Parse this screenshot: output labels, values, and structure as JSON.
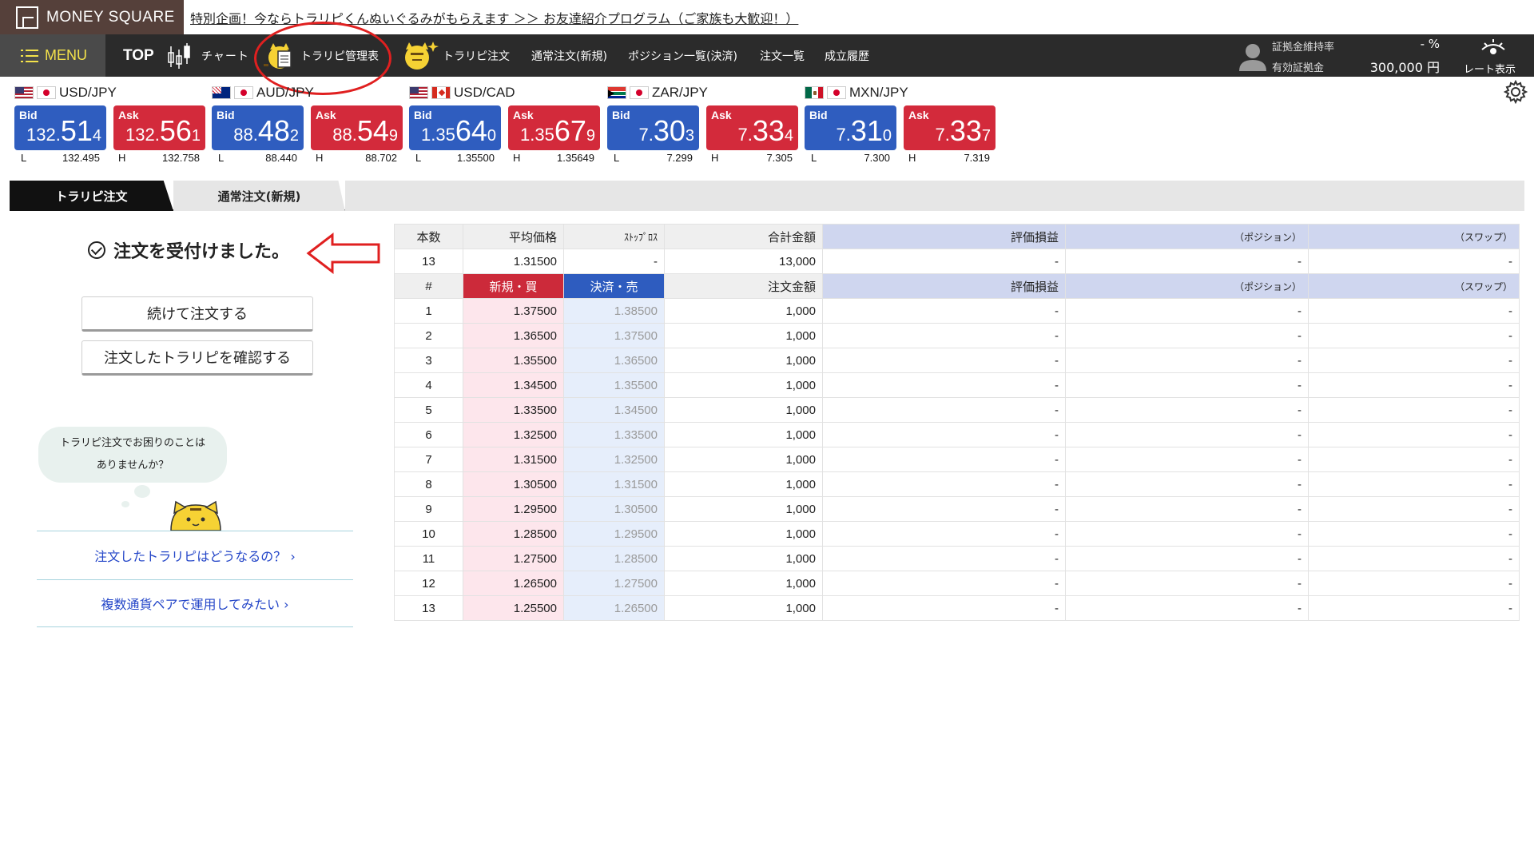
{
  "header": {
    "logo_text": "MONEY SQUARE",
    "promo": "特別企画！今ならトラリピくんぬいぐるみがもらえます ＞＞ お友達紹介プログラム（ご家族も大歓迎！）"
  },
  "nav": {
    "menu": "MENU",
    "top": "TOP",
    "chart": "チャート",
    "trarip_table": "トラリピ管理表",
    "trarip_order": "トラリピ注文",
    "normal_order": "通常注文(新規)",
    "positions": "ポジション一覧(決済)",
    "orders": "注文一覧",
    "history": "成立履歴",
    "margin_rate_label": "証拠金維持率",
    "margin_rate_value": "- %",
    "effective_margin_label": "有効証拠金",
    "effective_margin_value": "300,000 円",
    "rate_display": "レート表示"
  },
  "rates": [
    {
      "pair": "USD/JPY",
      "flags": [
        "us",
        "jp"
      ],
      "bid": {
        "a": "132.",
        "b": "51",
        "c": "4"
      },
      "ask": {
        "a": "132.",
        "b": "56",
        "c": "1"
      },
      "low": "132.495",
      "high": "132.758"
    },
    {
      "pair": "AUD/JPY",
      "flags": [
        "au",
        "jp"
      ],
      "bid": {
        "a": "88.",
        "b": "48",
        "c": "2"
      },
      "ask": {
        "a": "88.",
        "b": "54",
        "c": "9"
      },
      "low": "88.440",
      "high": "88.702"
    },
    {
      "pair": "USD/CAD",
      "flags": [
        "us",
        "ca"
      ],
      "bid": {
        "a": "1.35",
        "b": "64",
        "c": "0"
      },
      "ask": {
        "a": "1.35",
        "b": "67",
        "c": "9"
      },
      "low": "1.35500",
      "high": "1.35649"
    },
    {
      "pair": "ZAR/JPY",
      "flags": [
        "za",
        "jp"
      ],
      "bid": {
        "a": "7.",
        "b": "30",
        "c": "3"
      },
      "ask": {
        "a": "7.",
        "b": "33",
        "c": "4"
      },
      "low": "7.299",
      "high": "7.305"
    },
    {
      "pair": "MXN/JPY",
      "flags": [
        "mx",
        "jp"
      ],
      "bid": {
        "a": "7.",
        "b": "31",
        "c": "0"
      },
      "ask": {
        "a": "7.",
        "b": "33",
        "c": "7"
      },
      "low": "7.300",
      "high": "7.319"
    }
  ],
  "labels": {
    "bid": "Bid",
    "ask": "Ask",
    "low": "L",
    "high": "H"
  },
  "tabs": [
    {
      "label": "トラリピ注文",
      "active": true
    },
    {
      "label": "通常注文(新規)",
      "active": false
    }
  ],
  "result": {
    "message": "注文を受付けました。",
    "continue_button": "続けて注文する",
    "confirm_button": "注文したトラリピを確認する",
    "bubble_line1": "トラリピ注文でお困りのことは",
    "bubble_line2": "ありませんか？",
    "link1": "注文したトラリピはどうなるの？ ›",
    "link2": "複数通貨ペアで運用してみたい ›"
  },
  "summary_table": {
    "headers": [
      "本数",
      "平均価格",
      "ｽﾄｯﾌﾟﾛｽ",
      "合計金額",
      "評価損益",
      "（ポジション）",
      "（スワップ）"
    ],
    "row": [
      "13",
      "1.31500",
      "-",
      "13,000",
      "-",
      "-",
      "-"
    ]
  },
  "detail_table": {
    "headers": [
      "#",
      "新規・買",
      "決済・売",
      "注文金額",
      "評価損益",
      "（ポジション）",
      "（スワップ）"
    ],
    "rows": [
      [
        "1",
        "1.37500",
        "1.38500",
        "1,000",
        "-",
        "-",
        "-"
      ],
      [
        "2",
        "1.36500",
        "1.37500",
        "1,000",
        "-",
        "-",
        "-"
      ],
      [
        "3",
        "1.35500",
        "1.36500",
        "1,000",
        "-",
        "-",
        "-"
      ],
      [
        "4",
        "1.34500",
        "1.35500",
        "1,000",
        "-",
        "-",
        "-"
      ],
      [
        "5",
        "1.33500",
        "1.34500",
        "1,000",
        "-",
        "-",
        "-"
      ],
      [
        "6",
        "1.32500",
        "1.33500",
        "1,000",
        "-",
        "-",
        "-"
      ],
      [
        "7",
        "1.31500",
        "1.32500",
        "1,000",
        "-",
        "-",
        "-"
      ],
      [
        "8",
        "1.30500",
        "1.31500",
        "1,000",
        "-",
        "-",
        "-"
      ],
      [
        "9",
        "1.29500",
        "1.30500",
        "1,000",
        "-",
        "-",
        "-"
      ],
      [
        "10",
        "1.28500",
        "1.29500",
        "1,000",
        "-",
        "-",
        "-"
      ],
      [
        "11",
        "1.27500",
        "1.28500",
        "1,000",
        "-",
        "-",
        "-"
      ],
      [
        "12",
        "1.26500",
        "1.27500",
        "1,000",
        "-",
        "-",
        "-"
      ],
      [
        "13",
        "1.25500",
        "1.26500",
        "1,000",
        "-",
        "-",
        "-"
      ]
    ]
  },
  "colors": {
    "bid": "#2f5dbf",
    "ask": "#d32a3b",
    "nav": "#2b2b2b",
    "accent_yellow": "#f4e24a",
    "link": "#2446c8"
  }
}
